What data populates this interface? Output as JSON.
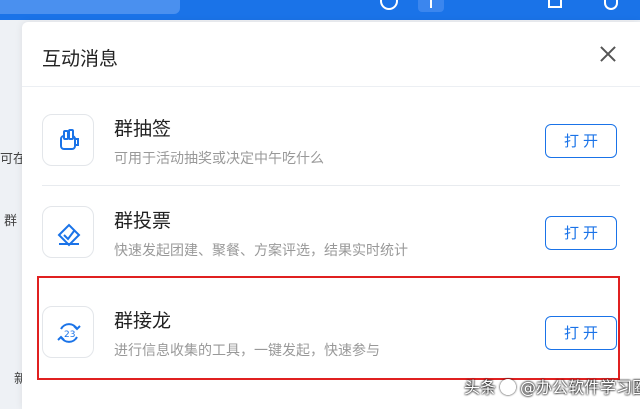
{
  "background": {
    "frag_1": "可在",
    "frag_2": "群",
    "frag_3": "新"
  },
  "panel": {
    "title": "互动消息",
    "close_icon": "close-icon",
    "open_label": "打开",
    "items": [
      {
        "name": "群抽签",
        "desc": "可用于活动抽奖或决定中午吃什么",
        "icon": "lottery-cup-icon",
        "open_label": "打开"
      },
      {
        "name": "群投票",
        "desc": "快速发起团建、聚餐、方案评选，结果实时统计",
        "icon": "vote-check-icon",
        "open_label": "打开"
      },
      {
        "name": "群接龙",
        "desc": "进行信息收集的工具，一键发起，快速参与",
        "icon": "relay-cycle-icon",
        "open_label": "打开"
      }
    ]
  },
  "watermark": {
    "prefix": "头条",
    "handle": "@办公软件学习圈"
  },
  "colors": {
    "accent": "#1a73e8",
    "highlight": "#e02020"
  }
}
